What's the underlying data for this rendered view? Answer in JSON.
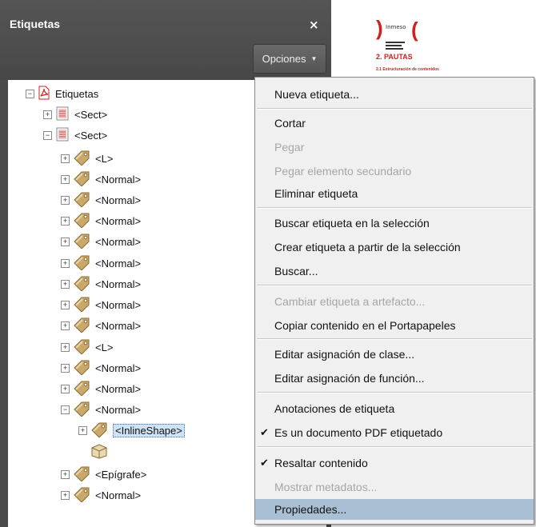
{
  "panel": {
    "title": "Etiquetas",
    "close_glyph": "×",
    "options_label": "Opciones"
  },
  "tree": {
    "root_label": "Etiquetas",
    "rows": [
      {
        "label": "<Sect>",
        "expander": "+",
        "icon": "document-icon"
      },
      {
        "label": "<Sect>",
        "expander": "−",
        "icon": "document-icon"
      },
      {
        "label": "<L>",
        "expander": "+",
        "icon": "tag-icon"
      },
      {
        "label": "<Normal>",
        "expander": "+",
        "icon": "tag-icon"
      },
      {
        "label": "<Normal>",
        "expander": "+",
        "icon": "tag-icon"
      },
      {
        "label": "<Normal>",
        "expander": "+",
        "icon": "tag-icon"
      },
      {
        "label": "<Normal>",
        "expander": "+",
        "icon": "tag-icon"
      },
      {
        "label": "<Normal>",
        "expander": "+",
        "icon": "tag-icon"
      },
      {
        "label": "<Normal>",
        "expander": "+",
        "icon": "tag-icon"
      },
      {
        "label": "<Normal>",
        "expander": "+",
        "icon": "tag-icon"
      },
      {
        "label": "<Normal>",
        "expander": "+",
        "icon": "tag-icon"
      },
      {
        "label": "<L>",
        "expander": "+",
        "icon": "tag-icon"
      },
      {
        "label": "<Normal>",
        "expander": "+",
        "icon": "tag-icon"
      },
      {
        "label": "<Normal>",
        "expander": "+",
        "icon": "tag-icon"
      },
      {
        "label": "<Normal>",
        "expander": "−",
        "icon": "tag-icon"
      },
      {
        "label": "<InlineShape>",
        "expander": "+",
        "icon": "tag-icon",
        "selected": true
      },
      {
        "label": "",
        "expander": "",
        "icon": "box-icon"
      },
      {
        "label": "<Epígrafe>",
        "expander": "+",
        "icon": "tag-icon"
      },
      {
        "label": "<Normal>",
        "expander": "+",
        "icon": "tag-icon"
      }
    ]
  },
  "document_preview": {
    "heading": "2. PAUTAS",
    "subheading": "2.1 Estructuración de contenidos",
    "brand": "Inmeso"
  },
  "menu": {
    "items": [
      {
        "label": "Nueva etiqueta...",
        "enabled": true
      },
      {
        "label": "Cortar",
        "enabled": true
      },
      {
        "label": "Pegar",
        "enabled": false
      },
      {
        "label": "Pegar elemento secundario",
        "enabled": false
      },
      {
        "label": "Eliminar etiqueta",
        "enabled": true
      },
      {
        "label": "Buscar etiqueta en la selección",
        "enabled": true
      },
      {
        "label": "Crear etiqueta a partir de la selección",
        "enabled": true
      },
      {
        "label": "Buscar...",
        "enabled": true
      },
      {
        "label": "Cambiar etiqueta a artefacto...",
        "enabled": false
      },
      {
        "label": "Copiar contenido en el Portapapeles",
        "enabled": true
      },
      {
        "label": "Editar asignación de clase...",
        "enabled": true
      },
      {
        "label": "Editar asignación de función...",
        "enabled": true
      },
      {
        "label": "Anotaciones de etiqueta",
        "enabled": true
      },
      {
        "label": "Es un documento PDF etiquetado",
        "enabled": true,
        "checked": true
      },
      {
        "label": "Resaltar contenido",
        "enabled": true,
        "checked": true
      },
      {
        "label": "Mostrar metadatos...",
        "enabled": false
      },
      {
        "label": "Propiedades...",
        "enabled": true,
        "highlighted": true
      }
    ],
    "check_glyph": "✔"
  },
  "colors": {
    "panel_bg": "#4a4a4a",
    "menu_highlight": "#a9bfd4",
    "pdf_red": "#d02020",
    "tag_icon": "#c9a86a"
  }
}
